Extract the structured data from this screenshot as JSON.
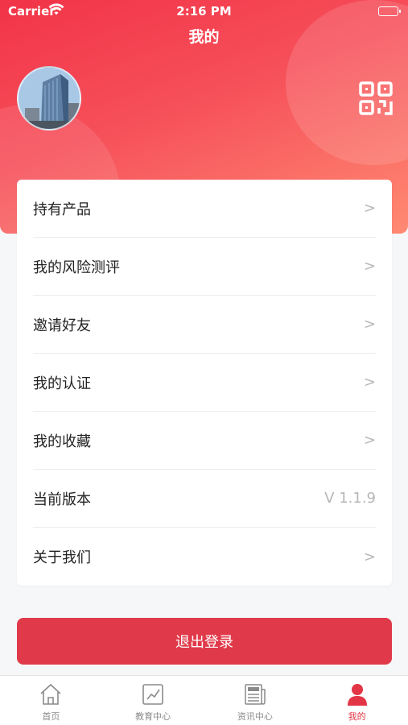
{
  "status_bar": {
    "carrier": "Carrier",
    "time": "2:16 PM"
  },
  "header": {
    "title": "我的",
    "avatar_icon": "building-photo",
    "qr_icon": "qr-code-icon"
  },
  "menu": {
    "items": [
      {
        "label": "持有产品",
        "arrow": ">"
      },
      {
        "label": "我的风险测评",
        "arrow": ">"
      },
      {
        "label": "邀请好友",
        "arrow": ">"
      },
      {
        "label": "我的认证",
        "arrow": ">"
      },
      {
        "label": "我的收藏",
        "arrow": ">"
      },
      {
        "label": "当前版本",
        "version": "V 1.1.9"
      },
      {
        "label": "关于我们",
        "arrow": ">"
      }
    ]
  },
  "logout_label": "退出登录",
  "tabbar": {
    "tabs": [
      {
        "label": "首页",
        "icon": "home-icon"
      },
      {
        "label": "教育中心",
        "icon": "chart-icon"
      },
      {
        "label": "资讯中心",
        "icon": "news-icon"
      },
      {
        "label": "我的",
        "icon": "person-icon",
        "active": true
      }
    ]
  },
  "colors": {
    "brand_red": "#e03a4a",
    "active_tab": "#e23646",
    "inactive_tab": "#8a8a8a"
  }
}
